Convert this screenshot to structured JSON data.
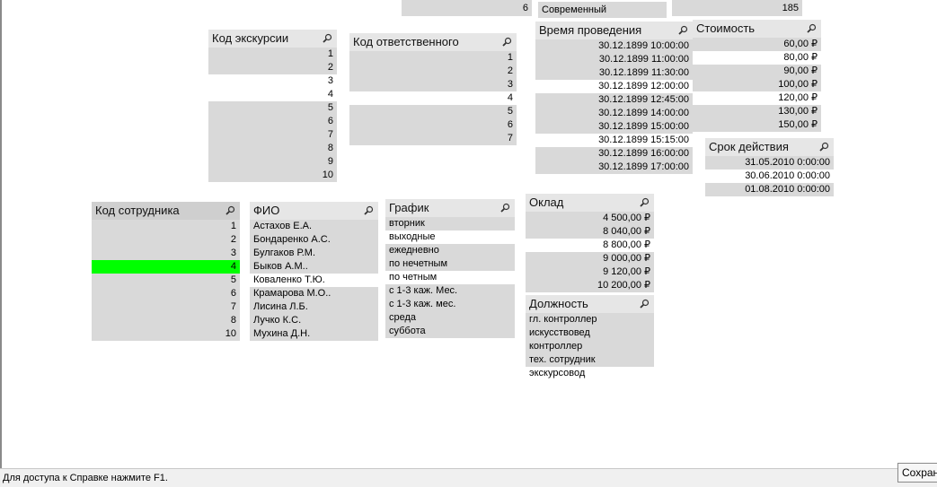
{
  "top_strips": {
    "a": "6",
    "b": "Современный",
    "c": "185"
  },
  "listboxes": {
    "kod_ekskursii": {
      "title": "Код экскурсии",
      "rows": [
        {
          "text": "1",
          "state": "gray"
        },
        {
          "text": "2",
          "state": "gray"
        },
        {
          "text": "3",
          "state": "white"
        },
        {
          "text": "4",
          "state": "white"
        },
        {
          "text": "5",
          "state": "gray"
        },
        {
          "text": "6",
          "state": "gray"
        },
        {
          "text": "7",
          "state": "gray"
        },
        {
          "text": "8",
          "state": "gray"
        },
        {
          "text": "9",
          "state": "gray"
        },
        {
          "text": "10",
          "state": "gray"
        }
      ]
    },
    "kod_otvetstvennogo": {
      "title": "Код ответственного",
      "rows": [
        {
          "text": "1",
          "state": "gray"
        },
        {
          "text": "2",
          "state": "gray"
        },
        {
          "text": "3",
          "state": "gray"
        },
        {
          "text": "4",
          "state": "white"
        },
        {
          "text": "5",
          "state": "gray"
        },
        {
          "text": "6",
          "state": "gray"
        },
        {
          "text": "7",
          "state": "gray"
        }
      ]
    },
    "vremya": {
      "title": "Время проведения",
      "rows": [
        {
          "text": "30.12.1899 10:00:00",
          "state": "gray"
        },
        {
          "text": "30.12.1899 11:00:00",
          "state": "gray"
        },
        {
          "text": "30.12.1899 11:30:00",
          "state": "gray"
        },
        {
          "text": "30.12.1899 12:00:00",
          "state": "white"
        },
        {
          "text": "30.12.1899 12:45:00",
          "state": "gray"
        },
        {
          "text": "30.12.1899 14:00:00",
          "state": "gray"
        },
        {
          "text": "30.12.1899 15:00:00",
          "state": "gray"
        },
        {
          "text": "30.12.1899 15:15:00",
          "state": "white"
        },
        {
          "text": "30.12.1899 16:00:00",
          "state": "gray"
        },
        {
          "text": "30.12.1899 17:00:00",
          "state": "gray"
        }
      ]
    },
    "stoimost": {
      "title": "Стоимость",
      "rows": [
        {
          "text": "60,00 ₽",
          "state": "gray"
        },
        {
          "text": "80,00 ₽",
          "state": "white"
        },
        {
          "text": "90,00 ₽",
          "state": "gray"
        },
        {
          "text": "100,00 ₽",
          "state": "gray"
        },
        {
          "text": "120,00 ₽",
          "state": "white"
        },
        {
          "text": "130,00 ₽",
          "state": "gray"
        },
        {
          "text": "150,00 ₽",
          "state": "gray"
        }
      ]
    },
    "srok": {
      "title": "Срок действия",
      "rows": [
        {
          "text": "31.05.2010 0:00:00",
          "state": "gray"
        },
        {
          "text": "30.06.2010 0:00:00",
          "state": "white"
        },
        {
          "text": "01.08.2010 0:00:00",
          "state": "gray"
        }
      ]
    },
    "kod_sotrudnika": {
      "title": "Код сотрудника",
      "rows": [
        {
          "text": "1",
          "state": "gray"
        },
        {
          "text": "2",
          "state": "gray"
        },
        {
          "text": "3",
          "state": "gray"
        },
        {
          "text": "4",
          "state": "green"
        },
        {
          "text": "5",
          "state": "gray"
        },
        {
          "text": "6",
          "state": "gray"
        },
        {
          "text": "7",
          "state": "gray"
        },
        {
          "text": "8",
          "state": "gray"
        },
        {
          "text": "10",
          "state": "gray"
        }
      ]
    },
    "fio": {
      "title": "ФИО",
      "rows": [
        {
          "text": "Астахов Е.А.",
          "state": "gray"
        },
        {
          "text": "Бондаренко А.С.",
          "state": "gray"
        },
        {
          "text": "Булгаков Р.М.",
          "state": "gray"
        },
        {
          "text": "Быков А.М..",
          "state": "gray"
        },
        {
          "text": "Коваленко Т.Ю.",
          "state": "white"
        },
        {
          "text": "Крамарова М.О..",
          "state": "gray"
        },
        {
          "text": "Лисина Л.Б.",
          "state": "gray"
        },
        {
          "text": "Лучко К.С.",
          "state": "gray"
        },
        {
          "text": "Мухина Д.Н.",
          "state": "gray"
        }
      ]
    },
    "grafik": {
      "title": "График",
      "rows": [
        {
          "text": "вторник",
          "state": "gray"
        },
        {
          "text": "выходные",
          "state": "white"
        },
        {
          "text": "ежедневно",
          "state": "gray"
        },
        {
          "text": "по нечетным",
          "state": "gray"
        },
        {
          "text": "по четным",
          "state": "white"
        },
        {
          "text": "с 1-3 каж. Мес.",
          "state": "gray"
        },
        {
          "text": "с 1-3 каж. мес.",
          "state": "gray"
        },
        {
          "text": "среда",
          "state": "gray"
        },
        {
          "text": "суббота",
          "state": "gray"
        }
      ]
    },
    "oklad": {
      "title": "Оклад",
      "rows": [
        {
          "text": "4 500,00 ₽",
          "state": "gray"
        },
        {
          "text": "8 040,00 ₽",
          "state": "gray"
        },
        {
          "text": "8 800,00 ₽",
          "state": "white"
        },
        {
          "text": "9 000,00 ₽",
          "state": "gray"
        },
        {
          "text": "9 120,00 ₽",
          "state": "gray"
        },
        {
          "text": "10 200,00 ₽",
          "state": "gray"
        }
      ]
    },
    "dolzhnost": {
      "title": "Должность",
      "rows": [
        {
          "text": "гл. контроллер",
          "state": "gray"
        },
        {
          "text": "искусствовед",
          "state": "gray"
        },
        {
          "text": "контроллер",
          "state": "gray"
        },
        {
          "text": "тех. сотрудник",
          "state": "gray"
        },
        {
          "text": "экскурсовод",
          "state": "white"
        }
      ]
    }
  },
  "status_bar": {
    "text": "Для доступа к Справке нажмите F1."
  },
  "tooltip": {
    "text": "Сохран"
  }
}
